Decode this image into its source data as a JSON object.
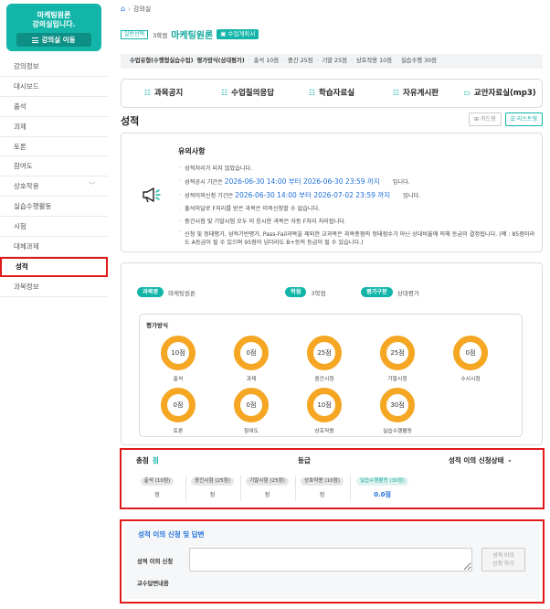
{
  "sidebar": {
    "course_title": "마케팅원론",
    "course_sub": "강의실입니다.",
    "course_button": "강의실 이동",
    "items": [
      {
        "label": "강의정보",
        "active": false,
        "expandable": false
      },
      {
        "label": "대시보드",
        "active": false,
        "expandable": false
      },
      {
        "label": "출석",
        "active": false,
        "expandable": false
      },
      {
        "label": "과제",
        "active": false,
        "expandable": false
      },
      {
        "label": "토론",
        "active": false,
        "expandable": false
      },
      {
        "label": "참여도",
        "active": false,
        "expandable": false
      },
      {
        "label": "상호작용",
        "active": false,
        "expandable": true
      },
      {
        "label": "실습수행활동",
        "active": false,
        "expandable": false
      },
      {
        "label": "시험",
        "active": false,
        "expandable": false
      },
      {
        "label": "대체과제",
        "active": false,
        "expandable": false
      },
      {
        "label": "성적",
        "active": true,
        "expandable": false
      },
      {
        "label": "과목정보",
        "active": false,
        "expandable": false
      }
    ]
  },
  "breadcrumb": {
    "current": "강의실"
  },
  "header": {
    "badge": "일반선택",
    "credit": "3학점",
    "course_name": "마케팅원론",
    "plan_button": "수업계획서"
  },
  "info_bar": {
    "type_label": "수업유형(수행형실습수업)",
    "method_label": "평가방식(상대평가)",
    "items": [
      "출석 10점",
      "중간 25점",
      "기말 25점",
      "상호작용 10점",
      "실습수행 30점"
    ]
  },
  "tabs": [
    {
      "label": "과목공지",
      "icon": "list-icon"
    },
    {
      "label": "수업질의응답",
      "icon": "list-icon"
    },
    {
      "label": "학습자료실",
      "icon": "list-icon"
    },
    {
      "label": "자유게시판",
      "icon": "list-icon"
    },
    {
      "label": "교안자료실(mp3)",
      "icon": "folder-icon"
    }
  ],
  "section_title": "성적",
  "view_buttons": {
    "card": "카드형",
    "list": "리스트형"
  },
  "notice": {
    "title": "유의사항",
    "line1": "성적처리가 되지 않았습니다.",
    "line2_prefix": "성적공시 기간은",
    "line2_date": "2026-06-30 14:00 부터 2026-06-30 23:59 까지",
    "line2_suffix": "입니다.",
    "line3_prefix": "성적이의신청 기간은",
    "line3_date": "2026-06-30 14:00 부터 2026-07-02 23:59 까지",
    "line3_suffix": "입니다.",
    "line4": "출석미달로 F처리를 받은 과목은 이의신청할 수 없습니다.",
    "line5": "중간시험 및 기말시험 모두 미 응시한 과목은 자동 F처리 처리됩니다.",
    "line6": "신청 및 정태평가, 성적기반평가, Pass-Fail과목을 제외한 교과목은 과목총점의 정태점수가 아닌 상대비율에 의해 등급이 결정됩니다. (예 : 85점이라도 A등급이 될 수 있으며 95점이 넘더라도 B+등의 등급이 될 수 있습니다.)"
  },
  "eval": {
    "course_pill": "과목명",
    "course_value": "마케팅원론",
    "credit_pill": "학점",
    "credit_value": "3학점",
    "type_pill": "평가구분",
    "type_value": "상대평가",
    "method_label": "평가방식",
    "items": [
      {
        "score": "10점",
        "label": "출석"
      },
      {
        "score": "0점",
        "label": "과제"
      },
      {
        "score": "25점",
        "label": "중간시험"
      },
      {
        "score": "25점",
        "label": "기말시험"
      },
      {
        "score": "0점",
        "label": "수시시험"
      },
      {
        "score": "0점",
        "label": "토론"
      },
      {
        "score": "0점",
        "label": "참여도"
      },
      {
        "score": "10점",
        "label": "상호작용"
      },
      {
        "score": "30점",
        "label": "실습수행활동"
      }
    ],
    "ring_color": "#f5a623"
  },
  "score": {
    "total_label": "총점",
    "total_value": "점",
    "grade_label": "등급",
    "appeal_label": "성적 이의 신청상태",
    "appeal_value": "-",
    "items": [
      {
        "tag": "출석 (10점)",
        "value": "점"
      },
      {
        "tag": "중간시험 (25점)",
        "value": "점"
      },
      {
        "tag": "기말시험 (25점)",
        "value": "점"
      },
      {
        "tag": "상호작용 (10점)",
        "value": "점"
      },
      {
        "tag": "실습수행활동 (30점)",
        "value": "0.0점"
      }
    ]
  },
  "appeal": {
    "title": "성적 이의 신청 및 답변",
    "input_label": "성적 이의 신청",
    "input_value": "",
    "button_line1": "성적 이의",
    "button_line2": "신청 하기",
    "answer_label": "교수답변내용"
  },
  "colors": {
    "accent": "#12b5a8",
    "link": "#1e6fd9",
    "highlight": "#e01a1a"
  }
}
